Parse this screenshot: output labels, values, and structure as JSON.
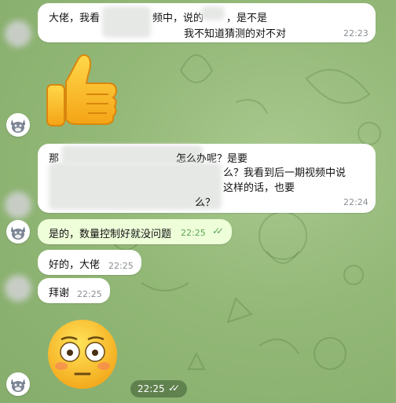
{
  "messages": [
    {
      "line1_a": "大佬，我看",
      "line1_b": "频中，说的",
      "line1_c": "，是不是",
      "line2": "我不知道猜测的对不对",
      "time": "22:23"
    },
    {
      "line1_a": "那",
      "line1_b": "怎么办呢？是要",
      "line2": "么？我看到后一期视频中说",
      "line3": "这样的话，也要",
      "line4": "么？",
      "time": "22:24"
    },
    {
      "text": "是的，数量控制好就没问题",
      "time": "22:25",
      "read_icon": "double-check-icon"
    },
    {
      "text": "好的，大佬",
      "time": "22:25"
    },
    {
      "text": "拜谢",
      "time": "22:25"
    }
  ],
  "stickers": [
    {
      "name": "thumbs-up-sticker",
      "emoji": "👍"
    },
    {
      "name": "flushed-face-sticker",
      "emoji": "😳"
    }
  ],
  "last_sticker_meta": {
    "time": "22:25",
    "read_icon": "double-check-icon"
  },
  "avatar_icon": "cat-avatar-icon",
  "colors": {
    "incoming_bubble": "#ffffff",
    "outgoing_bubble": "#eefed9",
    "check": "#5fa654"
  }
}
